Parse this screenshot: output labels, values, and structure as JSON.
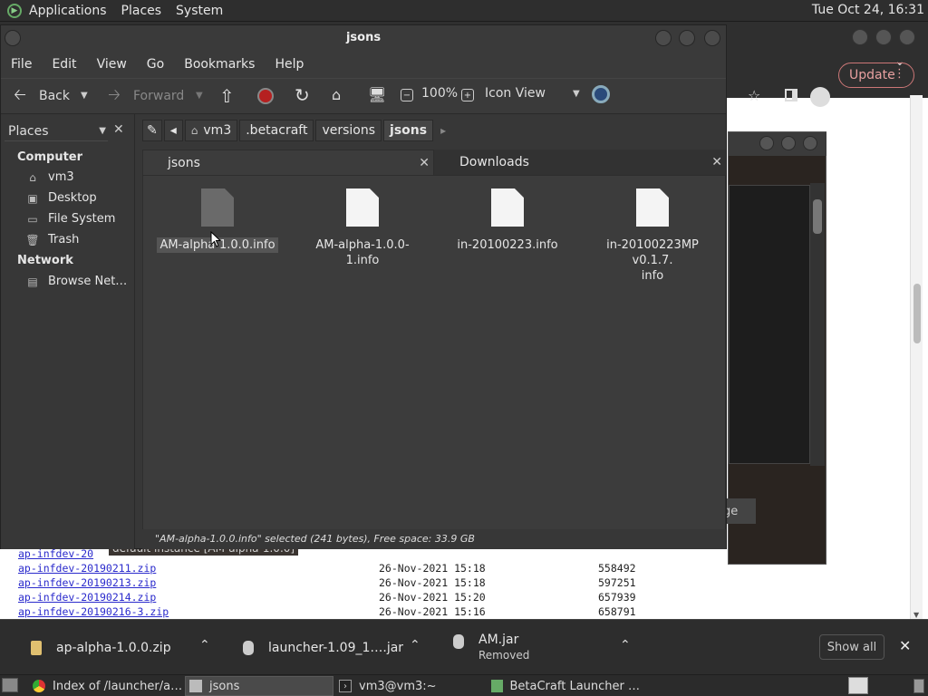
{
  "top_panel": {
    "menus": [
      "Applications",
      "Places",
      "System"
    ],
    "clock": "Tue Oct 24, 16:31"
  },
  "browser": {
    "update_label": "Update",
    "listing": [
      {
        "name": "ap-infdev-20",
        "date": "",
        "size": ""
      },
      {
        "name": "ap-infdev-20190211.zip",
        "date": "26-Nov-2021 15:18",
        "size": "558492"
      },
      {
        "name": "ap-infdev-20190213.zip",
        "date": "26-Nov-2021 15:18",
        "size": "597251"
      },
      {
        "name": "ap-infdev-20190214.zip",
        "date": "26-Nov-2021 15:20",
        "size": "657939"
      },
      {
        "name": "ap-infdev-20190216-3.zip",
        "date": "26-Nov-2021 15:16",
        "size": "658791"
      }
    ]
  },
  "betacraft": {
    "button_label": "ge",
    "status": "default instance [AM-alpha-1.0.0]"
  },
  "file_manager": {
    "title": "jsons",
    "menu": [
      "File",
      "Edit",
      "View",
      "Go",
      "Bookmarks",
      "Help"
    ],
    "toolbar": {
      "back": "Back",
      "forward": "Forward",
      "zoom": "100%",
      "view_mode": "Icon View"
    },
    "sidebar": {
      "header": "Places",
      "computer_label": "Computer",
      "network_label": "Network",
      "computer_items": [
        "vm3",
        "Desktop",
        "File System",
        "Trash"
      ],
      "network_items": [
        "Browse Net…"
      ]
    },
    "path": [
      "vm3",
      ".betacraft",
      "versions",
      "jsons"
    ],
    "tabs": [
      "jsons",
      "Downloads"
    ],
    "files": [
      {
        "name": "AM-alpha-1.0.0.info",
        "line2": "",
        "selected": true
      },
      {
        "name": "AM-alpha-1.0.0-1.info",
        "line2": "",
        "selected": false
      },
      {
        "name": "in-20100223.info",
        "line2": "",
        "selected": false
      },
      {
        "name": "in-20100223MP v0.1.7.",
        "line2": "info",
        "selected": false
      }
    ],
    "status": "\"AM-alpha-1.0.0.info\" selected (241 bytes), Free space: 33.9 GB"
  },
  "downloads": {
    "items": [
      {
        "name": "ap-alpha-1.0.0.zip",
        "sub": ""
      },
      {
        "name": "launcher-1.09_1….jar",
        "sub": ""
      },
      {
        "name": "AM.jar",
        "sub": "Removed"
      }
    ],
    "show_all": "Show all"
  },
  "taskbar": {
    "tasks": [
      "Index of /launcher/a…",
      "jsons",
      "vm3@vm3:~",
      "BetaCraft Launcher …"
    ]
  },
  "colors": {
    "panel": "#2e2e2e",
    "window": "#373737",
    "link": "#2a2acc",
    "accent_update": "#e8a0a0"
  }
}
